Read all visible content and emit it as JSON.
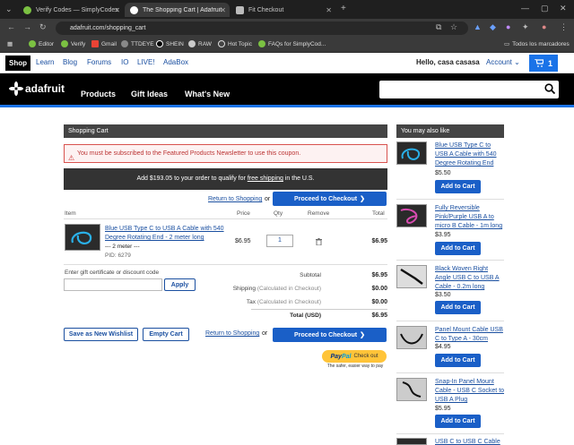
{
  "browser": {
    "tabs": [
      {
        "title": "Verify Codes — SimplyCodes",
        "color": "#7bc142"
      },
      {
        "title": "The Shopping Cart | Adafruit In",
        "color": "#ffffff"
      },
      {
        "title": "Fit Checkout",
        "color": "#bbbbbb"
      }
    ],
    "new_tab": "+",
    "url": "adafruit.com/shopping_cart",
    "bookmarks": [
      "Editor",
      "Verify",
      "Gmail",
      "TTDEYE",
      "SHEIN",
      "RAW",
      "Hot Topic",
      "FAQs for SimplyCod..."
    ],
    "all_bookmarks": "Todos los marcadores"
  },
  "topnav": {
    "shop": "Shop",
    "items": [
      "Learn",
      "Blog",
      "Forums",
      "IO",
      "LIVE!",
      "AdaBox"
    ],
    "hello": "Hello, casa casasa",
    "account": "Account",
    "cart_count": "1"
  },
  "header": {
    "logo": "adafruit",
    "nav": [
      "Products",
      "Gift Ideas",
      "What's New"
    ],
    "search_placeholder": ""
  },
  "cart": {
    "title": "Shopping Cart",
    "alert": "You must be subscribed to the Featured Products Newsletter to use this coupon.",
    "free_shipping_pre": "Add $193.05 to your order to qualify for ",
    "free_shipping_link": "free shipping",
    "free_shipping_post": " in the U.S.",
    "return_link": "Return to Shopping",
    "or": "or",
    "checkout": "Proceed to Checkout",
    "columns": {
      "item": "Item",
      "price": "Price",
      "qty": "Qty",
      "remove": "Remove",
      "total": "Total"
    },
    "line_item": {
      "name": "Blue USB Type C to USB A Cable with 540 Degree Rotating End - 2 meter long",
      "option": "--- 2 meter ---",
      "pid": "PID: 6279",
      "price": "$6.95",
      "qty": "1",
      "total": "$6.95"
    },
    "coupon_label": "Enter gift certificate or discount code",
    "apply": "Apply",
    "subtotal_label": "Subtotal",
    "subtotal": "$6.95",
    "shipping_label": "Shipping",
    "shipping_note": "(Calculated in Checkout)",
    "shipping": "$0.00",
    "tax_label": "Tax",
    "tax_note": "(Calculated in Checkout)",
    "tax": "$0.00",
    "total_label": "Total (USD)",
    "total": "$6.95",
    "wishlist": "Save as New Wishlist",
    "empty": "Empty Cart",
    "paypal_a": "Pay",
    "paypal_b": "Pal",
    "paypal_c": "Check out",
    "paypal_tag": "The safer, easier way to pay"
  },
  "sidebar": {
    "title": "You may also like",
    "add_label": "Add to Cart",
    "items": [
      {
        "name": "Blue USB Type C to USB A Cable with 540 Degree Rotating End",
        "price": "$5.50"
      },
      {
        "name": "Fully Reversible Pink/Purple USB A to micro B Cable - 1m long",
        "price": "$3.95"
      },
      {
        "name": "Black Woven Right Angle USB C to USB A Cable - 0.2m long",
        "price": "$3.50"
      },
      {
        "name": "Panel Mount Cable USB C to Type A - 30cm",
        "price": "$4.95"
      },
      {
        "name": "Snap-In Panel Mount Cable - USB C Socket to USB A Plug",
        "price": "$5.95"
      },
      {
        "name": "USB C to USB C Cable"
      }
    ]
  }
}
